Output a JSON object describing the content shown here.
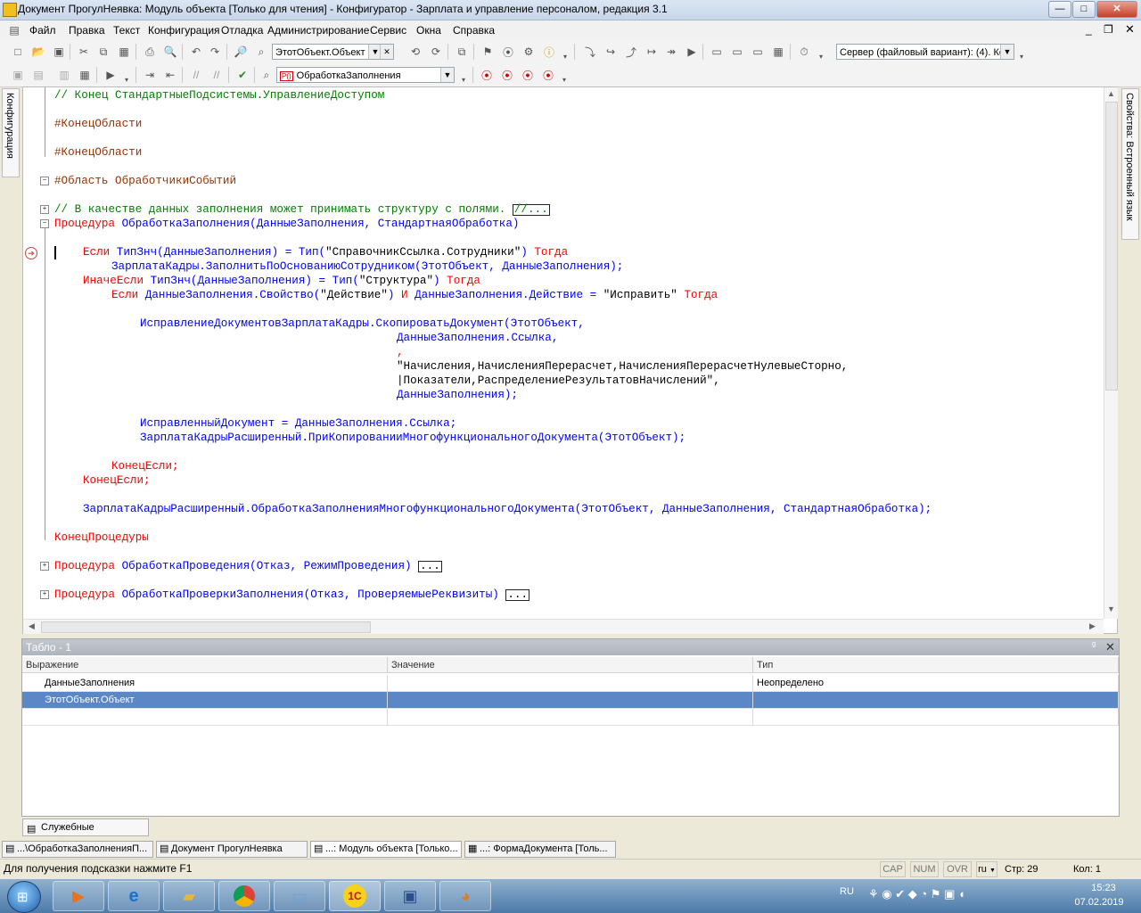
{
  "window": {
    "title": "Документ ПрогулНеявка: Модуль объекта [Только для чтения] - Конфигуратор - Зарплата и управление персоналом, редакция 3.1",
    "controls": {
      "minimize": "—",
      "maximize": "□",
      "close": "✕"
    }
  },
  "menu": {
    "items": [
      "Файл",
      "Правка",
      "Текст",
      "Конфигурация",
      "Отладка",
      "Администрирование",
      "Сервис",
      "Окна",
      "Справка"
    ]
  },
  "toolbar": {
    "expression_combo": "ЭтотОбъект.Объект",
    "server_combo": "Сервер (файловый вариант): (4). Ко",
    "procedure_combo": "ОбработкаЗаполнения",
    "procedure_combo_badge": "P()"
  },
  "side_tabs": {
    "left": "Конфигурация",
    "right": "Свойства: Встроенный язык"
  },
  "code": {
    "l1": "// Конец СтандартныеПодсистемы.УправлениеДоступом",
    "l2": "#КонецОбласти",
    "l3": "#КонецОбласти",
    "l4": "#Область ОбработчикиСобытий",
    "l5": "// В качестве данных заполнения может принимать структуру с полями.",
    "l5_ellipsis": "//...",
    "l6_kw": "Процедура",
    "l6_rest": " ОбработкаЗаполнения(ДанныеЗаполнения, СтандартнаяОбработка)",
    "l7_kw1": "Если",
    "l7_a": " ТипЗнч(ДанныеЗаполнения) = Тип(",
    "l7_str": "\"СправочникСсылка.Сотрудники\"",
    "l7_b": ") ",
    "l7_kw2": "Тогда",
    "l8": "ЗарплатаКадры.ЗаполнитьПоОснованиюСотрудником(ЭтотОбъект, ДанныеЗаполнения);",
    "l9_kw1": "ИначеЕсли",
    "l9_a": " ТипЗнч(ДанныеЗаполнения) = Тип(",
    "l9_str": "\"Структура\"",
    "l9_b": ") ",
    "l9_kw2": "Тогда",
    "l10_kw1": "Если",
    "l10_a": " ДанныеЗаполнения.Свойство(",
    "l10_str1": "\"Действие\"",
    "l10_b": ") ",
    "l10_kw2": "И",
    "l10_c": " ДанныеЗаполнения.Действие = ",
    "l10_str2": "\"Исправить\"",
    "l10_d": " ",
    "l10_kw3": "Тогда",
    "l11": "ИсправлениеДокументовЗарплатаКадры.СкопироватьДокумент(ЭтотОбъект,",
    "l12": "ДанныеЗаполнения.Ссылка,",
    "l13": ",",
    "l14": "\"Начисления,НачисленияПерерасчет,НачисленияПерерасчетНулевыеСторно,",
    "l15": "|Показатели,РаспределениеРезультатовНачислений\",",
    "l16": "ДанныеЗаполнения);",
    "l17": "ИсправленныйДокумент = ДанныеЗаполнения.Ссылка;",
    "l18": "ЗарплатаКадрыРасширенный.ПриКопированииМногофункциональногоДокумента(ЭтотОбъект);",
    "l19": "КонецЕсли;",
    "l20": "КонецЕсли;",
    "l21": "ЗарплатаКадрыРасширенный.ОбработкаЗаполненияМногофункциональногоДокумента(ЭтотОбъект, ДанныеЗаполнения, СтандартнаяОбработка);",
    "l22": "КонецПроцедуры",
    "l23_kw": "Процедура",
    "l23_rest": " ОбработкаПроведения(Отказ, РежимПроведения)",
    "l24_kw": "Процедура",
    "l24_rest": " ОбработкаПроверкиЗаполнения(Отказ, ПроверяемыеРеквизиты)",
    "collapsed_marker": "..."
  },
  "tablo": {
    "title": "Табло - 1",
    "pin": "ᵍ",
    "close": "✕",
    "columns": [
      "Выражение",
      "Значение",
      "Тип"
    ],
    "rows": [
      {
        "expr": "ДанныеЗаполнения",
        "value": "",
        "type": "Неопределено"
      },
      {
        "expr": "ЭтотОбъект.Объект",
        "value": "",
        "type": ""
      }
    ]
  },
  "messages_tab": "Служебные сообщения",
  "window_tabs": [
    "...\\ОбработкаЗаполненияП...",
    "Документ ПрогулНеявка",
    "...: Модуль объекта [Только...",
    "...: ФормаДокумента [Толь..."
  ],
  "status": {
    "hint": "Для получения подсказки нажмите F1",
    "cap": "CAP",
    "num": "NUM",
    "ovr": "OVR",
    "lang": "ru",
    "line": "Стр: 29",
    "col": "Кол: 1"
  },
  "taskbar": {
    "lang": "RU",
    "time": "15:23",
    "date": "07.02.2019"
  },
  "colors": {
    "comment": "#008000",
    "keyword": "#ff0000",
    "identifier": "#0000ff",
    "selection": "#5b87c7"
  }
}
